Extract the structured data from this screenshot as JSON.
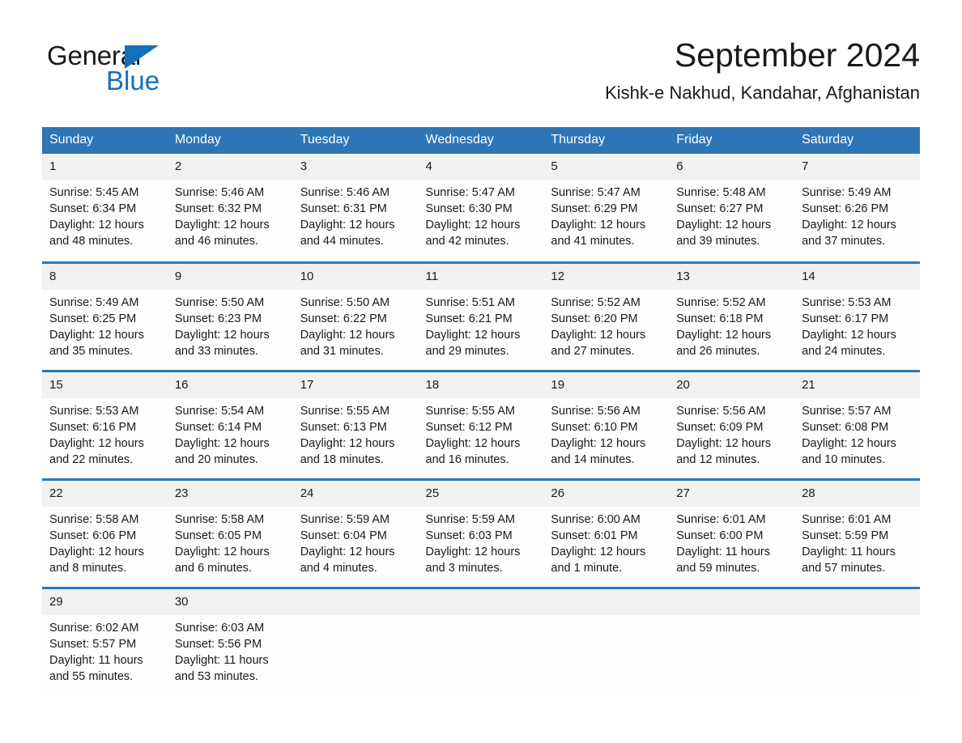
{
  "brand": {
    "name_part1": "General",
    "name_part2": "Blue",
    "triangle_color": "#1570b8"
  },
  "header": {
    "title": "September 2024",
    "subtitle": "Kishk-e Nakhud, Kandahar, Afghanistan"
  },
  "colors": {
    "header_blue": "#2e75b6",
    "daynum_gray": "#f1f1f1",
    "row_divider_blue": "#2e75b6"
  },
  "weekday_headers": [
    "Sunday",
    "Monday",
    "Tuesday",
    "Wednesday",
    "Thursday",
    "Friday",
    "Saturday"
  ],
  "weeks": [
    {
      "days": [
        {
          "num": "1",
          "sunrise": "Sunrise: 5:45 AM",
          "sunset": "Sunset: 6:34 PM",
          "daylight_line1": "Daylight: 12 hours",
          "daylight_line2": "and 48 minutes."
        },
        {
          "num": "2",
          "sunrise": "Sunrise: 5:46 AM",
          "sunset": "Sunset: 6:32 PM",
          "daylight_line1": "Daylight: 12 hours",
          "daylight_line2": "and 46 minutes."
        },
        {
          "num": "3",
          "sunrise": "Sunrise: 5:46 AM",
          "sunset": "Sunset: 6:31 PM",
          "daylight_line1": "Daylight: 12 hours",
          "daylight_line2": "and 44 minutes."
        },
        {
          "num": "4",
          "sunrise": "Sunrise: 5:47 AM",
          "sunset": "Sunset: 6:30 PM",
          "daylight_line1": "Daylight: 12 hours",
          "daylight_line2": "and 42 minutes."
        },
        {
          "num": "5",
          "sunrise": "Sunrise: 5:47 AM",
          "sunset": "Sunset: 6:29 PM",
          "daylight_line1": "Daylight: 12 hours",
          "daylight_line2": "and 41 minutes."
        },
        {
          "num": "6",
          "sunrise": "Sunrise: 5:48 AM",
          "sunset": "Sunset: 6:27 PM",
          "daylight_line1": "Daylight: 12 hours",
          "daylight_line2": "and 39 minutes."
        },
        {
          "num": "7",
          "sunrise": "Sunrise: 5:49 AM",
          "sunset": "Sunset: 6:26 PM",
          "daylight_line1": "Daylight: 12 hours",
          "daylight_line2": "and 37 minutes."
        }
      ]
    },
    {
      "days": [
        {
          "num": "8",
          "sunrise": "Sunrise: 5:49 AM",
          "sunset": "Sunset: 6:25 PM",
          "daylight_line1": "Daylight: 12 hours",
          "daylight_line2": "and 35 minutes."
        },
        {
          "num": "9",
          "sunrise": "Sunrise: 5:50 AM",
          "sunset": "Sunset: 6:23 PM",
          "daylight_line1": "Daylight: 12 hours",
          "daylight_line2": "and 33 minutes."
        },
        {
          "num": "10",
          "sunrise": "Sunrise: 5:50 AM",
          "sunset": "Sunset: 6:22 PM",
          "daylight_line1": "Daylight: 12 hours",
          "daylight_line2": "and 31 minutes."
        },
        {
          "num": "11",
          "sunrise": "Sunrise: 5:51 AM",
          "sunset": "Sunset: 6:21 PM",
          "daylight_line1": "Daylight: 12 hours",
          "daylight_line2": "and 29 minutes."
        },
        {
          "num": "12",
          "sunrise": "Sunrise: 5:52 AM",
          "sunset": "Sunset: 6:20 PM",
          "daylight_line1": "Daylight: 12 hours",
          "daylight_line2": "and 27 minutes."
        },
        {
          "num": "13",
          "sunrise": "Sunrise: 5:52 AM",
          "sunset": "Sunset: 6:18 PM",
          "daylight_line1": "Daylight: 12 hours",
          "daylight_line2": "and 26 minutes."
        },
        {
          "num": "14",
          "sunrise": "Sunrise: 5:53 AM",
          "sunset": "Sunset: 6:17 PM",
          "daylight_line1": "Daylight: 12 hours",
          "daylight_line2": "and 24 minutes."
        }
      ]
    },
    {
      "days": [
        {
          "num": "15",
          "sunrise": "Sunrise: 5:53 AM",
          "sunset": "Sunset: 6:16 PM",
          "daylight_line1": "Daylight: 12 hours",
          "daylight_line2": "and 22 minutes."
        },
        {
          "num": "16",
          "sunrise": "Sunrise: 5:54 AM",
          "sunset": "Sunset: 6:14 PM",
          "daylight_line1": "Daylight: 12 hours",
          "daylight_line2": "and 20 minutes."
        },
        {
          "num": "17",
          "sunrise": "Sunrise: 5:55 AM",
          "sunset": "Sunset: 6:13 PM",
          "daylight_line1": "Daylight: 12 hours",
          "daylight_line2": "and 18 minutes."
        },
        {
          "num": "18",
          "sunrise": "Sunrise: 5:55 AM",
          "sunset": "Sunset: 6:12 PM",
          "daylight_line1": "Daylight: 12 hours",
          "daylight_line2": "and 16 minutes."
        },
        {
          "num": "19",
          "sunrise": "Sunrise: 5:56 AM",
          "sunset": "Sunset: 6:10 PM",
          "daylight_line1": "Daylight: 12 hours",
          "daylight_line2": "and 14 minutes."
        },
        {
          "num": "20",
          "sunrise": "Sunrise: 5:56 AM",
          "sunset": "Sunset: 6:09 PM",
          "daylight_line1": "Daylight: 12 hours",
          "daylight_line2": "and 12 minutes."
        },
        {
          "num": "21",
          "sunrise": "Sunrise: 5:57 AM",
          "sunset": "Sunset: 6:08 PM",
          "daylight_line1": "Daylight: 12 hours",
          "daylight_line2": "and 10 minutes."
        }
      ]
    },
    {
      "days": [
        {
          "num": "22",
          "sunrise": "Sunrise: 5:58 AM",
          "sunset": "Sunset: 6:06 PM",
          "daylight_line1": "Daylight: 12 hours",
          "daylight_line2": "and 8 minutes."
        },
        {
          "num": "23",
          "sunrise": "Sunrise: 5:58 AM",
          "sunset": "Sunset: 6:05 PM",
          "daylight_line1": "Daylight: 12 hours",
          "daylight_line2": "and 6 minutes."
        },
        {
          "num": "24",
          "sunrise": "Sunrise: 5:59 AM",
          "sunset": "Sunset: 6:04 PM",
          "daylight_line1": "Daylight: 12 hours",
          "daylight_line2": "and 4 minutes."
        },
        {
          "num": "25",
          "sunrise": "Sunrise: 5:59 AM",
          "sunset": "Sunset: 6:03 PM",
          "daylight_line1": "Daylight: 12 hours",
          "daylight_line2": "and 3 minutes."
        },
        {
          "num": "26",
          "sunrise": "Sunrise: 6:00 AM",
          "sunset": "Sunset: 6:01 PM",
          "daylight_line1": "Daylight: 12 hours",
          "daylight_line2": "and 1 minute."
        },
        {
          "num": "27",
          "sunrise": "Sunrise: 6:01 AM",
          "sunset": "Sunset: 6:00 PM",
          "daylight_line1": "Daylight: 11 hours",
          "daylight_line2": "and 59 minutes."
        },
        {
          "num": "28",
          "sunrise": "Sunrise: 6:01 AM",
          "sunset": "Sunset: 5:59 PM",
          "daylight_line1": "Daylight: 11 hours",
          "daylight_line2": "and 57 minutes."
        }
      ]
    },
    {
      "days": [
        {
          "num": "29",
          "sunrise": "Sunrise: 6:02 AM",
          "sunset": "Sunset: 5:57 PM",
          "daylight_line1": "Daylight: 11 hours",
          "daylight_line2": "and 55 minutes."
        },
        {
          "num": "30",
          "sunrise": "Sunrise: 6:03 AM",
          "sunset": "Sunset: 5:56 PM",
          "daylight_line1": "Daylight: 11 hours",
          "daylight_line2": "and 53 minutes."
        },
        {
          "num": "",
          "sunrise": "",
          "sunset": "",
          "daylight_line1": "",
          "daylight_line2": ""
        },
        {
          "num": "",
          "sunrise": "",
          "sunset": "",
          "daylight_line1": "",
          "daylight_line2": ""
        },
        {
          "num": "",
          "sunrise": "",
          "sunset": "",
          "daylight_line1": "",
          "daylight_line2": ""
        },
        {
          "num": "",
          "sunrise": "",
          "sunset": "",
          "daylight_line1": "",
          "daylight_line2": ""
        },
        {
          "num": "",
          "sunrise": "",
          "sunset": "",
          "daylight_line1": "",
          "daylight_line2": ""
        }
      ]
    }
  ]
}
